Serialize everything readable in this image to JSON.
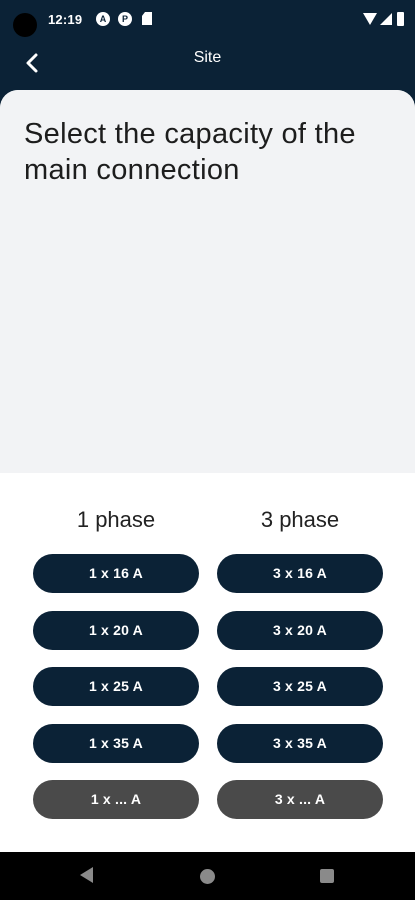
{
  "status_bar": {
    "time": "12:19",
    "icon1": "A",
    "icon2": "P"
  },
  "header": {
    "title": "Site"
  },
  "question": "Select the capacity of the main connection",
  "columns": {
    "one_phase": "1 phase",
    "three_phase": "3 phase"
  },
  "options": {
    "one_phase": [
      "1 x 16 A",
      "1 x 20 A",
      "1 x 25 A",
      "1 x 35 A",
      "1 x ... A"
    ],
    "three_phase": [
      "3 x 16 A",
      "3 x 20 A",
      "3 x 25 A",
      "3 x 35 A",
      "3 x ... A"
    ]
  },
  "colors": {
    "primary": "#0b2236",
    "custom_option": "#4a4a4a",
    "question_bg": "#f2f3f5"
  }
}
